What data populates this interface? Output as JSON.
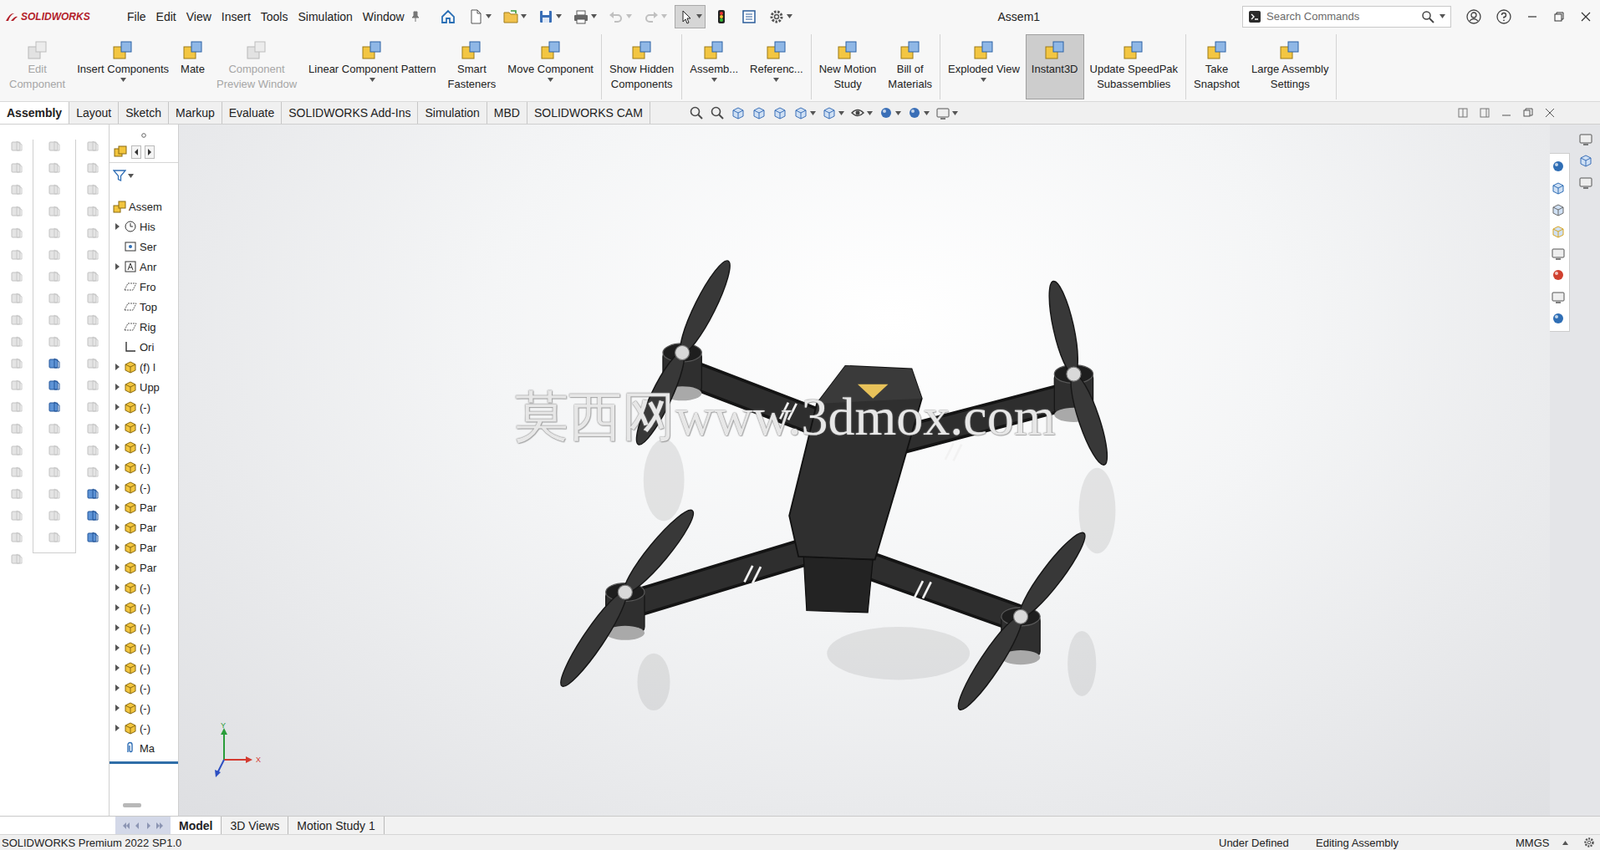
{
  "app": {
    "logo": "SOLIDWORKS"
  },
  "window": {
    "title": "Assem1"
  },
  "menu": [
    "File",
    "Edit",
    "View",
    "Insert",
    "Tools",
    "Simulation",
    "Window"
  ],
  "quick_access": [
    {
      "kind": "home",
      "disabled": false,
      "selected": false,
      "dropdown": false
    },
    {
      "kind": "new",
      "disabled": false,
      "selected": false,
      "dropdown": true
    },
    {
      "kind": "open",
      "disabled": false,
      "selected": false,
      "dropdown": true
    },
    {
      "kind": "save",
      "disabled": false,
      "selected": false,
      "dropdown": true
    },
    {
      "kind": "print",
      "disabled": false,
      "selected": false,
      "dropdown": true
    },
    {
      "kind": "undo",
      "disabled": true,
      "selected": false,
      "dropdown": true
    },
    {
      "kind": "redo",
      "disabled": true,
      "selected": false,
      "dropdown": true
    },
    {
      "kind": "select",
      "disabled": false,
      "selected": true,
      "dropdown": true
    },
    {
      "kind": "rebuild",
      "disabled": false,
      "selected": false,
      "dropdown": false
    },
    {
      "kind": "properties",
      "disabled": false,
      "selected": false,
      "dropdown": false
    },
    {
      "kind": "options",
      "disabled": false,
      "selected": false,
      "dropdown": true
    }
  ],
  "search": {
    "placeholder": "Search Commands"
  },
  "ribbon": [
    [
      {
        "label": [
          "Edit",
          "Component"
        ],
        "disabled": true,
        "selected": false,
        "dropdown": false
      },
      {
        "label": [
          "Insert Components"
        ],
        "disabled": false,
        "selected": false,
        "dropdown": true
      },
      {
        "label": [
          "Mate"
        ],
        "disabled": false,
        "selected": false,
        "dropdown": false
      },
      {
        "label": [
          "Component",
          "Preview Window"
        ],
        "disabled": true,
        "selected": false,
        "dropdown": false
      },
      {
        "label": [
          "Linear Component Pattern"
        ],
        "disabled": false,
        "selected": false,
        "dropdown": true
      },
      {
        "label": [
          "Smart",
          "Fasteners"
        ],
        "disabled": false,
        "selected": false,
        "dropdown": false
      },
      {
        "label": [
          "Move Component"
        ],
        "disabled": false,
        "selected": false,
        "dropdown": true
      }
    ],
    [
      {
        "label": [
          "Show Hidden",
          "Components"
        ],
        "disabled": false,
        "selected": false,
        "dropdown": false
      }
    ],
    [
      {
        "label": [
          "Assemb..."
        ],
        "disabled": false,
        "selected": false,
        "dropdown": true
      },
      {
        "label": [
          "Referenc..."
        ],
        "disabled": false,
        "selected": false,
        "dropdown": true
      }
    ],
    [
      {
        "label": [
          "New Motion",
          "Study"
        ],
        "disabled": false,
        "selected": false,
        "dropdown": false
      },
      {
        "label": [
          "Bill of",
          "Materials"
        ],
        "disabled": false,
        "selected": false,
        "dropdown": false
      }
    ],
    [
      {
        "label": [
          "Exploded View"
        ],
        "disabled": false,
        "selected": false,
        "dropdown": true
      },
      {
        "label": [
          "Instant3D"
        ],
        "disabled": false,
        "selected": true,
        "dropdown": false
      },
      {
        "label": [
          "Update SpeedPak",
          "Subassemblies"
        ],
        "disabled": false,
        "selected": false,
        "dropdown": false
      }
    ],
    [
      {
        "label": [
          "Take",
          "Snapshot"
        ],
        "disabled": false,
        "selected": false,
        "dropdown": false
      },
      {
        "label": [
          "Large Assembly",
          "Settings"
        ],
        "disabled": false,
        "selected": false,
        "dropdown": false
      }
    ]
  ],
  "tabs": [
    {
      "label": "Assembly",
      "selected": true
    },
    {
      "label": "Layout",
      "selected": false
    },
    {
      "label": "Sketch",
      "selected": false
    },
    {
      "label": "Markup",
      "selected": false
    },
    {
      "label": "Evaluate",
      "selected": false
    },
    {
      "label": "SOLIDWORKS Add-Ins",
      "selected": false
    },
    {
      "label": "Simulation",
      "selected": false
    },
    {
      "label": "MBD",
      "selected": false
    },
    {
      "label": "SOLIDWORKS CAM",
      "selected": false
    }
  ],
  "shortcut_bar": [
    [
      {
        "disabled": true
      },
      {
        "disabled": true
      },
      {
        "disabled": true
      },
      {
        "disabled": true
      },
      {
        "disabled": true
      },
      {
        "disabled": true
      },
      {
        "disabled": true
      },
      {
        "disabled": true
      },
      {
        "disabled": true
      },
      {
        "disabled": true
      },
      {
        "disabled": true
      },
      {
        "disabled": true
      },
      {
        "disabled": true
      },
      {
        "disabled": true
      },
      {
        "disabled": true
      },
      {
        "disabled": true
      },
      {
        "disabled": true
      },
      {
        "disabled": true
      },
      {
        "disabled": true
      },
      {
        "disabled": true
      }
    ],
    [
      {
        "disabled": true
      },
      {
        "disabled": true
      },
      {
        "disabled": true
      },
      {
        "disabled": true
      },
      {
        "disabled": true
      },
      {
        "disabled": true
      },
      {
        "disabled": true
      },
      {
        "disabled": true
      },
      {
        "disabled": true
      },
      {
        "disabled": true
      },
      {
        "disabled": false
      },
      {
        "disabled": false
      },
      {
        "disabled": false
      },
      {
        "disabled": true
      },
      {
        "disabled": true
      },
      {
        "disabled": true
      },
      {
        "disabled": true
      },
      {
        "disabled": true
      },
      {
        "disabled": true
      }
    ],
    [
      {
        "disabled": true
      },
      {
        "disabled": true
      },
      {
        "disabled": true
      },
      {
        "disabled": true
      },
      {
        "disabled": true
      },
      {
        "disabled": true
      },
      {
        "disabled": true
      },
      {
        "disabled": true
      },
      {
        "disabled": true
      },
      {
        "disabled": true
      },
      {
        "disabled": true
      },
      {
        "disabled": true
      },
      {
        "disabled": true
      },
      {
        "disabled": true
      },
      {
        "disabled": true
      },
      {
        "disabled": true
      },
      {
        "disabled": false
      },
      {
        "disabled": false
      },
      {
        "disabled": false
      }
    ]
  ],
  "feature_tree": {
    "items": [
      {
        "label": "Assem",
        "kind": "assembly",
        "level": 0,
        "expander": false,
        "expanded": false
      },
      {
        "label": "His",
        "kind": "history",
        "level": 1,
        "expander": true,
        "expanded": false
      },
      {
        "label": "Ser",
        "kind": "sensors",
        "level": 1,
        "expander": false,
        "expanded": false
      },
      {
        "label": "Anr",
        "kind": "annotations",
        "level": 1,
        "expander": true,
        "expanded": false
      },
      {
        "label": "Fro",
        "kind": "plane",
        "level": 1,
        "expander": false,
        "expanded": false
      },
      {
        "label": "Top",
        "kind": "plane",
        "level": 1,
        "expander": false,
        "expanded": false
      },
      {
        "label": "Rig",
        "kind": "plane",
        "level": 1,
        "expander": false,
        "expanded": false
      },
      {
        "label": "Ori",
        "kind": "origin",
        "level": 1,
        "expander": false,
        "expanded": false
      },
      {
        "label": "(f) l",
        "kind": "part",
        "level": 1,
        "expander": true,
        "expanded": false
      },
      {
        "label": "Upp",
        "kind": "part",
        "level": 1,
        "expander": true,
        "expanded": false
      },
      {
        "label": "(-)",
        "kind": "part",
        "level": 1,
        "expander": true,
        "expanded": false
      },
      {
        "label": "(-)",
        "kind": "part",
        "level": 1,
        "expander": true,
        "expanded": false
      },
      {
        "label": "(-)",
        "kind": "part",
        "level": 1,
        "expander": true,
        "expanded": false
      },
      {
        "label": "(-)",
        "kind": "part",
        "level": 1,
        "expander": true,
        "expanded": false
      },
      {
        "label": "(-)",
        "kind": "part",
        "level": 1,
        "expander": true,
        "expanded": false
      },
      {
        "label": "Par",
        "kind": "part",
        "level": 1,
        "expander": true,
        "expanded": false
      },
      {
        "label": "Par",
        "kind": "part",
        "level": 1,
        "expander": true,
        "expanded": false
      },
      {
        "label": "Par",
        "kind": "part",
        "level": 1,
        "expander": true,
        "expanded": false
      },
      {
        "label": "Par",
        "kind": "part",
        "level": 1,
        "expander": true,
        "expanded": false
      },
      {
        "label": "(-)",
        "kind": "part",
        "level": 1,
        "expander": true,
        "expanded": false
      },
      {
        "label": "(-)",
        "kind": "part",
        "level": 1,
        "expander": true,
        "expanded": false
      },
      {
        "label": "(-)",
        "kind": "part",
        "level": 1,
        "expander": true,
        "expanded": false
      },
      {
        "label": "(-)",
        "kind": "part",
        "level": 1,
        "expander": true,
        "expanded": false
      },
      {
        "label": "(-)",
        "kind": "part",
        "level": 1,
        "expander": true,
        "expanded": false
      },
      {
        "label": "(-)",
        "kind": "part",
        "level": 1,
        "expander": true,
        "expanded": false
      },
      {
        "label": "(-)",
        "kind": "part",
        "level": 1,
        "expander": true,
        "expanded": false
      },
      {
        "label": "(-)",
        "kind": "part",
        "level": 1,
        "expander": true,
        "expanded": false
      },
      {
        "label": "Ma",
        "kind": "mates",
        "level": 1,
        "expander": false,
        "expanded": false
      }
    ]
  },
  "watermark": "莫西网www.3dmox.com",
  "triad": {
    "y": "Y",
    "x": "X"
  },
  "bottom_tabs": [
    {
      "label": "Model",
      "selected": true
    },
    {
      "label": "3D Views",
      "selected": false
    },
    {
      "label": "Motion Study 1",
      "selected": false
    }
  ],
  "status_bar": {
    "product": "SOLIDWORKS Premium 2022 SP1.0",
    "items": [
      "Under Defined",
      "Editing Assembly",
      "MMGS"
    ]
  }
}
